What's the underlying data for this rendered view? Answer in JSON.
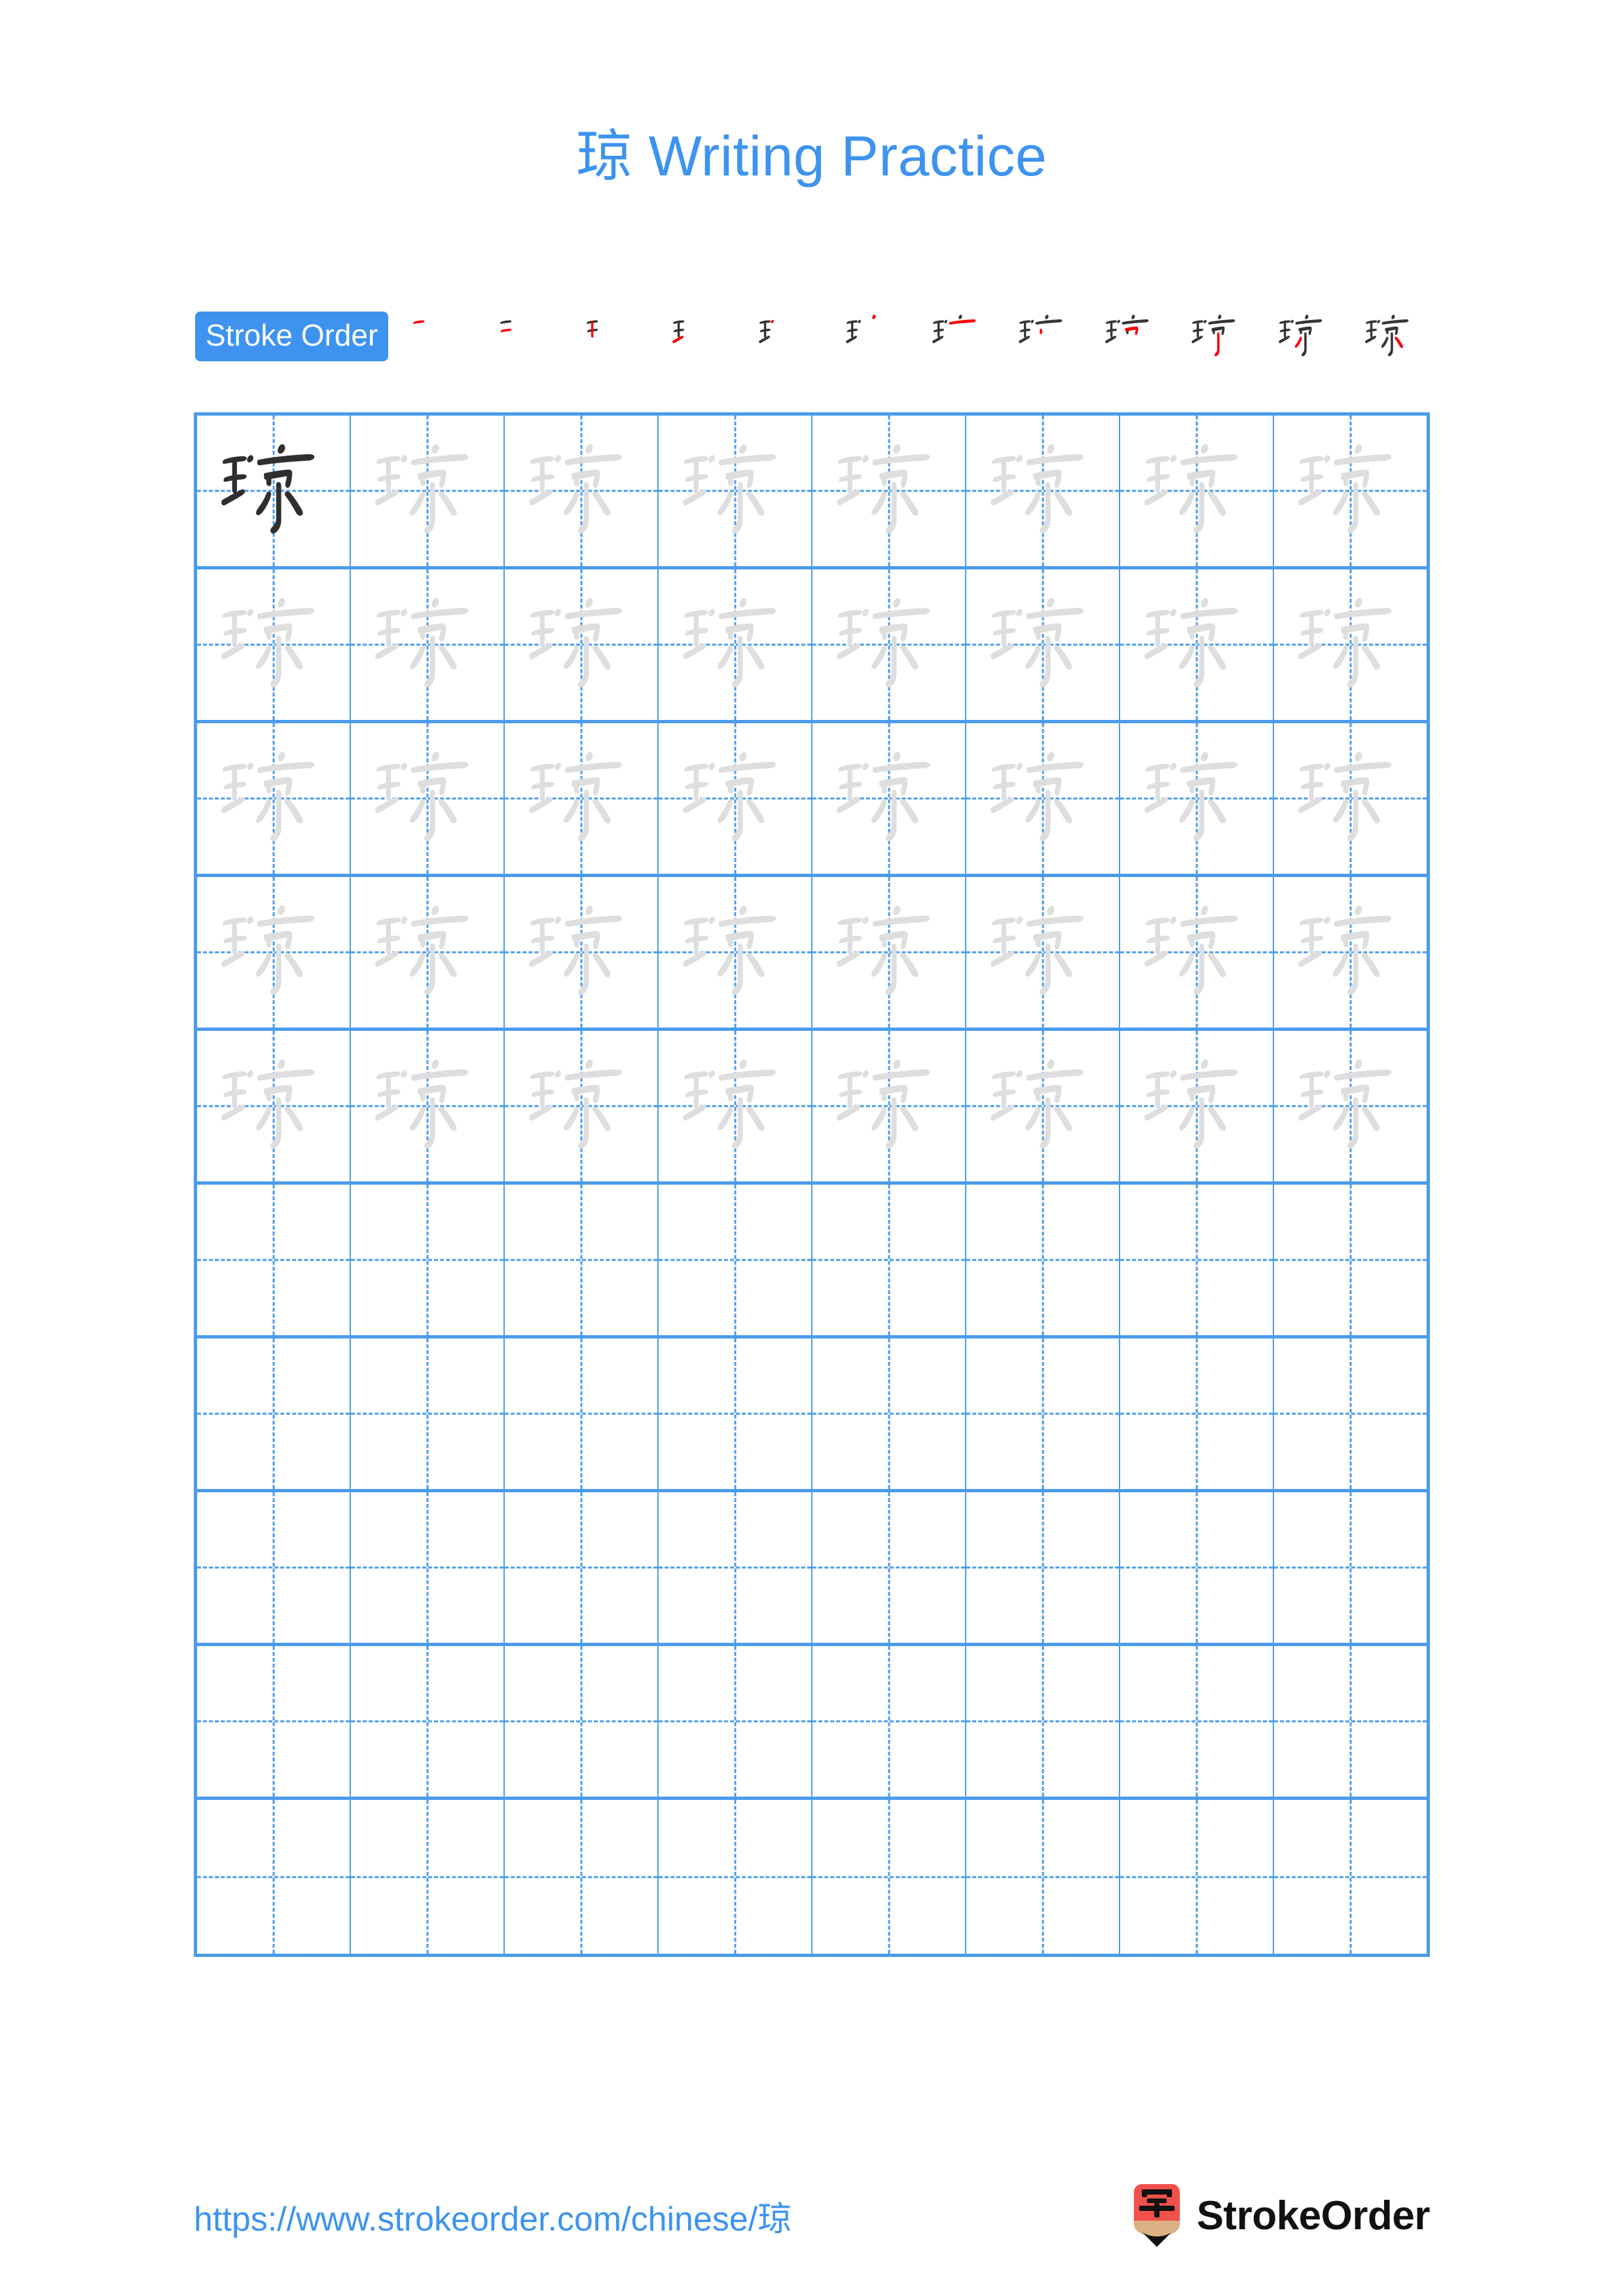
{
  "page": {
    "character": "琼",
    "title": "琼 Writing Practice",
    "title_color": "#3d93ef",
    "background": "#ffffff"
  },
  "stroke_order": {
    "label": "Stroke Order",
    "label_bg": "#3d93ef",
    "label_color": "#ffffff",
    "stroke_count": 12,
    "existing_stroke_color": "#353535",
    "new_stroke_color": "#fb0007",
    "steps": [
      {
        "index": 1,
        "new_stroke": "横 (héng)",
        "strokes_shown": 1
      },
      {
        "index": 2,
        "new_stroke": "横 (héng)",
        "strokes_shown": 2
      },
      {
        "index": 3,
        "new_stroke": "竖 (shù)",
        "strokes_shown": 3
      },
      {
        "index": 4,
        "new_stroke": "提 (tí)",
        "strokes_shown": 4
      },
      {
        "index": 5,
        "new_stroke": "点 (diǎn)",
        "strokes_shown": 5
      },
      {
        "index": 6,
        "new_stroke": "点 (diǎn)",
        "strokes_shown": 6
      },
      {
        "index": 7,
        "new_stroke": "横 (héng)",
        "strokes_shown": 7
      },
      {
        "index": 8,
        "new_stroke": "竖 (shù)",
        "strokes_shown": 8
      },
      {
        "index": 9,
        "new_stroke": "横折 (héngzhé)",
        "strokes_shown": 9
      },
      {
        "index": 10,
        "new_stroke": "竖钩 (shùgōu)",
        "strokes_shown": 10
      },
      {
        "index": 11,
        "new_stroke": "撇 (piě)",
        "strokes_shown": 11
      },
      {
        "index": 12,
        "new_stroke": "捺 (nà)",
        "strokes_shown": 12
      }
    ]
  },
  "grid": {
    "columns": 8,
    "rows": 10,
    "line_color": "#4a9bec",
    "guide_style": "dashed",
    "dark_glyph_color": "#2f2f2f",
    "light_glyph_color": "#dedede",
    "rows_data": [
      {
        "row": 1,
        "cells": [
          "dark",
          "light",
          "light",
          "light",
          "light",
          "light",
          "light",
          "light"
        ]
      },
      {
        "row": 2,
        "cells": [
          "light",
          "light",
          "light",
          "light",
          "light",
          "light",
          "light",
          "light"
        ]
      },
      {
        "row": 3,
        "cells": [
          "light",
          "light",
          "light",
          "light",
          "light",
          "light",
          "light",
          "light"
        ]
      },
      {
        "row": 4,
        "cells": [
          "light",
          "light",
          "light",
          "light",
          "light",
          "light",
          "light",
          "light"
        ]
      },
      {
        "row": 5,
        "cells": [
          "light",
          "light",
          "light",
          "light",
          "light",
          "light",
          "light",
          "light"
        ]
      },
      {
        "row": 6,
        "cells": [
          "empty",
          "empty",
          "empty",
          "empty",
          "empty",
          "empty",
          "empty",
          "empty"
        ]
      },
      {
        "row": 7,
        "cells": [
          "empty",
          "empty",
          "empty",
          "empty",
          "empty",
          "empty",
          "empty",
          "empty"
        ]
      },
      {
        "row": 8,
        "cells": [
          "empty",
          "empty",
          "empty",
          "empty",
          "empty",
          "empty",
          "empty",
          "empty"
        ]
      },
      {
        "row": 9,
        "cells": [
          "empty",
          "empty",
          "empty",
          "empty",
          "empty",
          "empty",
          "empty",
          "empty"
        ]
      },
      {
        "row": 10,
        "cells": [
          "empty",
          "empty",
          "empty",
          "empty",
          "empty",
          "empty",
          "empty",
          "empty"
        ]
      }
    ]
  },
  "footer": {
    "url": "https://www.strokeorder.com/chinese/琼",
    "url_color": "#3d93ef",
    "brand_name": "StrokeOrder",
    "logo_icon": "pencil-logo-icon",
    "logo_character": "字",
    "logo_body_color": "#f1514b",
    "logo_wood_color": "#dcb183",
    "logo_tip_color": "#111111"
  }
}
